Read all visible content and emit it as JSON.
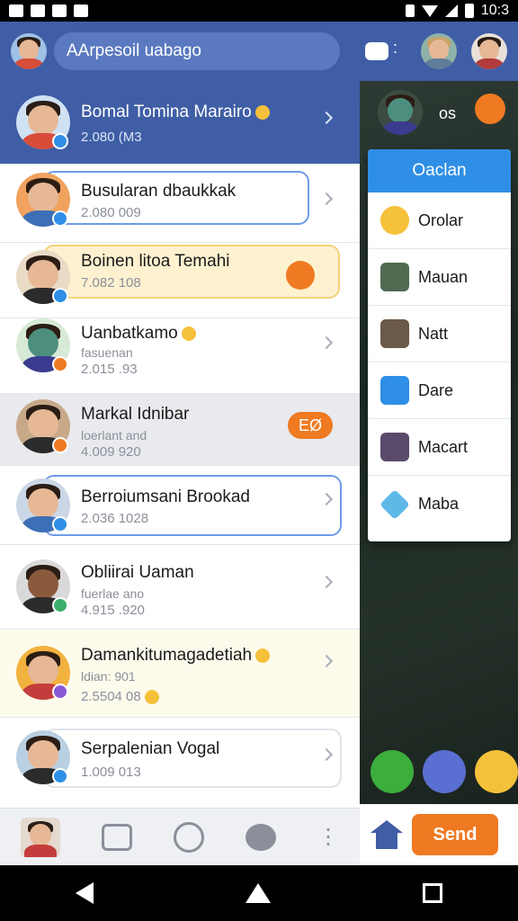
{
  "status": {
    "time": "10:3"
  },
  "header": {
    "search_text": "AArpesoil uabago"
  },
  "chats": [
    {
      "name": "Bomal Tomina Marairo",
      "meta": "2.080 (M3",
      "has_emoji": true
    },
    {
      "name": "Busularan dbaukkak",
      "meta": "2.080 009"
    },
    {
      "name": "Boinen litoa Temahi",
      "meta": "7.082 108"
    },
    {
      "name": "Uanbatkamo",
      "sub": "fasuenan",
      "meta": "2.015 .93",
      "has_emoji": true
    },
    {
      "name": "Markal Idnibar",
      "sub": "loerlant and",
      "meta": "4.009 920",
      "pill": "EØ"
    },
    {
      "name": "Berroiumsani Brookad",
      "meta": "2.036 1028"
    },
    {
      "name": "Obliirai Uaman",
      "sub": "fuerlae ano",
      "meta": "4.915 .920"
    },
    {
      "name": "Damankitumagadetiah",
      "sub": "ldian: 901",
      "meta": "2.5504 08",
      "has_emoji": true
    },
    {
      "name": "Serpalenian Vogal",
      "meta": "1.009 013"
    }
  ],
  "right_panel": {
    "label": "os"
  },
  "dropdown": {
    "header": "Oaclan",
    "items": [
      {
        "label": "Orolar",
        "icon": "emoji-icon"
      },
      {
        "label": "Mauan",
        "icon": "photo-icon"
      },
      {
        "label": "Natt",
        "icon": "photo-icon"
      },
      {
        "label": "Dare",
        "icon": "plus-icon"
      },
      {
        "label": "Macart",
        "icon": "photo-icon"
      },
      {
        "label": "Maba",
        "icon": "diamond-icon"
      }
    ]
  },
  "actions": {
    "send_label": "Send"
  },
  "colors": {
    "primary": "#3f5ea6",
    "accent": "#ef7a22",
    "dropdown_header": "#2f8fe6"
  }
}
